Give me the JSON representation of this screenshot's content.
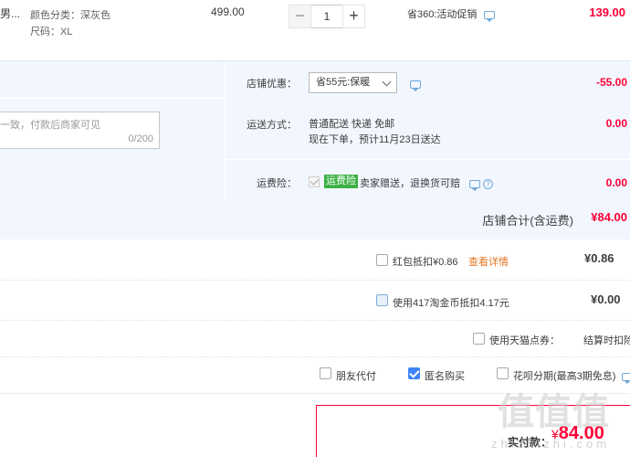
{
  "product": {
    "title_fragment": "男...",
    "color_attr": "颜色分类：深灰色",
    "size_attr": "尺码：XL",
    "unit_price": "499.00",
    "quantity": "1",
    "minus_glyph": "−",
    "plus_glyph": "+",
    "promo": "省360:活动促销",
    "row_total": "139.00"
  },
  "shop": {
    "memo_placeholder": "一致，付款后商家可见",
    "memo_count": "0/200",
    "discount_label": "店铺优惠：",
    "discount_selected": "省55元:保暖",
    "discount_amount": "-55.00",
    "shipping_label": "运送方式：",
    "shipping_method": "普通配送 快递 免邮",
    "shipping_eta": "现在下单，预计11月23日送达",
    "shipping_amount": "0.00",
    "insurance_label": "运费险：",
    "insurance_badge": "运费险",
    "insurance_text": "卖家赠送，退换货可赔",
    "insurance_amount": "0.00",
    "total_label": "店铺合计(含运费)",
    "total_amount": "¥84.00"
  },
  "redpacket": {
    "label": "红包抵扣¥0.86",
    "link": "查看详情",
    "amount": "¥0.86"
  },
  "taojinbi": {
    "label": "使用417淘金币抵扣4.17元",
    "amount": "¥0.00"
  },
  "tmall_points": {
    "label": "使用天猫点券：",
    "note": "结算时扣除"
  },
  "options": {
    "friend_pay": "朋友代付",
    "anonymous": "匿名购买",
    "huabei": "花呗分期(最高3期免息)"
  },
  "pay": {
    "label": "实付款：",
    "yen": "¥",
    "amount": "84.00"
  },
  "watermark": {
    "logo": "值值值",
    "site": "zhizhizhi.com"
  },
  "colors": {
    "accent_red": "#ff0036",
    "shop_bg": "#f2f7ff",
    "check_blue": "#3d85f7"
  }
}
